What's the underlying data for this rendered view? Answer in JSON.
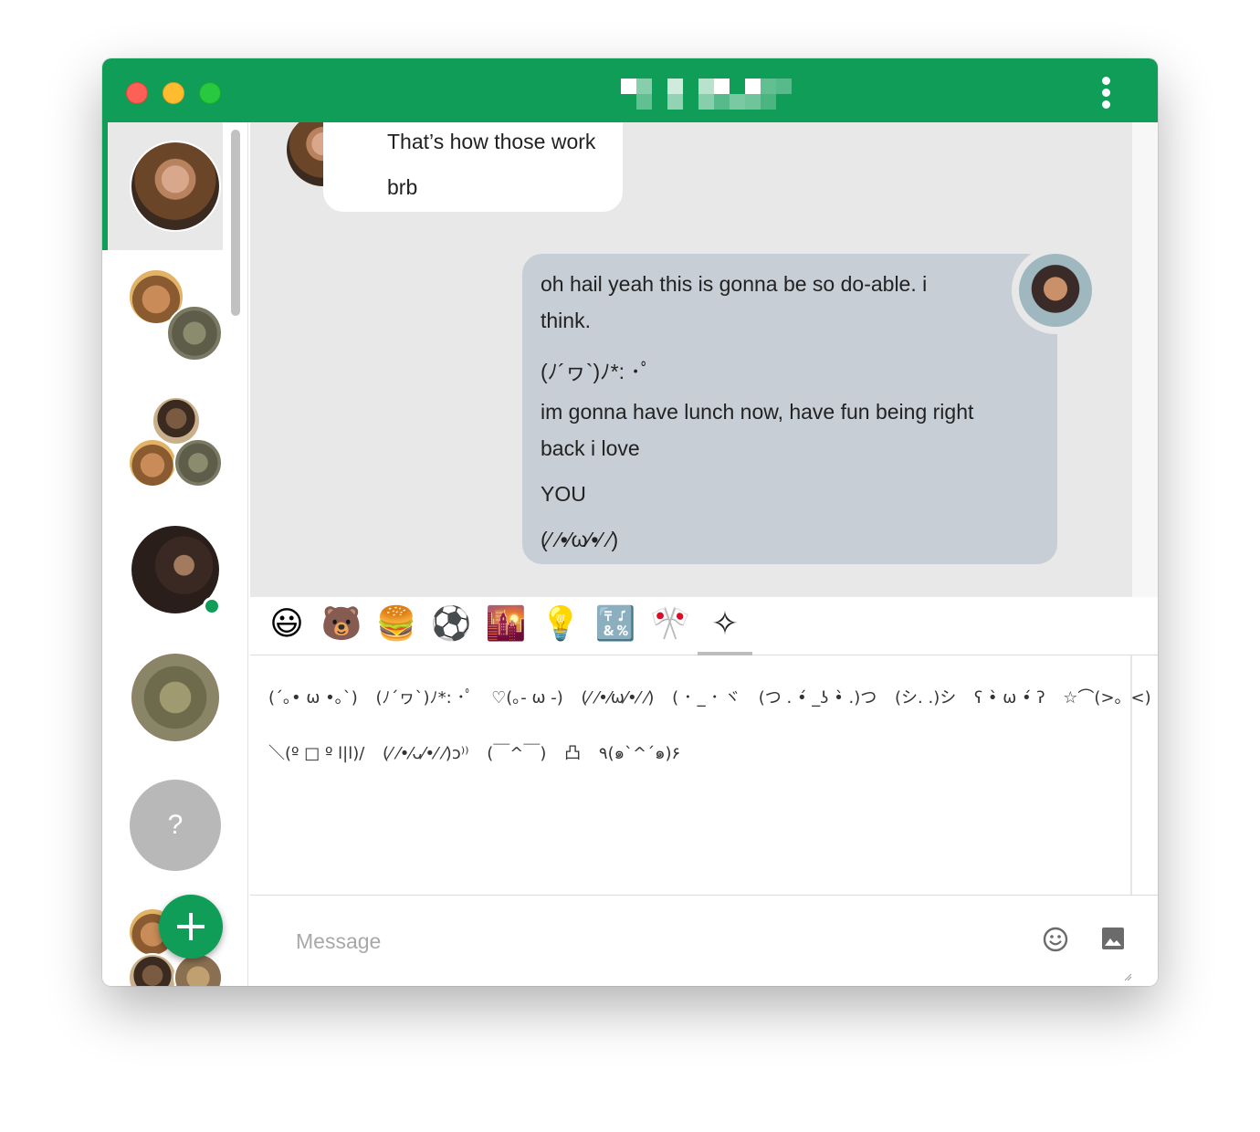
{
  "window": {
    "title": ""
  },
  "colors": {
    "accent": "#0f9d58",
    "incoming_bubble": "#ffffff",
    "outgoing_bubble": "#c7ced6",
    "chat_bg": "#e8e8e8"
  },
  "sidebar": {
    "conversations": [
      {
        "id": "conv-1",
        "active": true
      },
      {
        "id": "conv-2"
      },
      {
        "id": "conv-3"
      },
      {
        "id": "conv-4",
        "online": true
      },
      {
        "id": "conv-5"
      },
      {
        "id": "conv-6",
        "avatar_text": "?"
      },
      {
        "id": "conv-7"
      }
    ],
    "new_chat_icon": "plus-icon"
  },
  "messages": {
    "incoming": [
      "That’s how those work",
      "brb"
    ],
    "outgoing": [
      "oh hail yeah this is gonna be so do-able. i",
      "think.",
      "(ﾉ´ヮ`)ﾉ*: ･ﾟ",
      "im gonna have lunch now, have fun being right",
      "back i love",
      "YOU",
      "(⁄ ⁄•⁄ω⁄•⁄ ⁄)"
    ]
  },
  "emoji_picker": {
    "tabs": [
      {
        "name": "smileys",
        "glyph": "😃"
      },
      {
        "name": "animals",
        "glyph": "🐻"
      },
      {
        "name": "food",
        "glyph": "🍔"
      },
      {
        "name": "activity",
        "glyph": "⚽"
      },
      {
        "name": "travel",
        "glyph": "🌇"
      },
      {
        "name": "objects",
        "glyph": "💡"
      },
      {
        "name": "symbols",
        "glyph": "🔣"
      },
      {
        "name": "flags",
        "glyph": "🎌"
      },
      {
        "name": "kaomoji",
        "glyph": "✧"
      }
    ],
    "active_tab": "kaomoji",
    "kaomoji_rows": [
      [
        "(´｡• ω •｡`)",
        "(ﾉ´ヮ`)ﾉ*: ･ﾟ",
        "♡(｡- ω -)",
        "(⁄ ⁄•⁄ω⁄•⁄ ⁄)",
        "( ･ _ ･ ヾ",
        "(つ . •́ _ʖ •̀ .)つ",
        "(シ. .)シ",
        "ʕ •̀ ω •́ ʔ",
        "☆⌒(>。<)"
      ],
      [
        "＼(º □ º l|l)/",
        "(⁄ ⁄•⁄ᴗ⁄•⁄ ⁄)ↄ⁾⁾",
        "(￣^￣)",
        "凸",
        "٩(๑`^´๑)۶"
      ]
    ]
  },
  "composer": {
    "placeholder": "Message",
    "emoji_icon": "smiley-icon",
    "image_icon": "image-icon"
  }
}
